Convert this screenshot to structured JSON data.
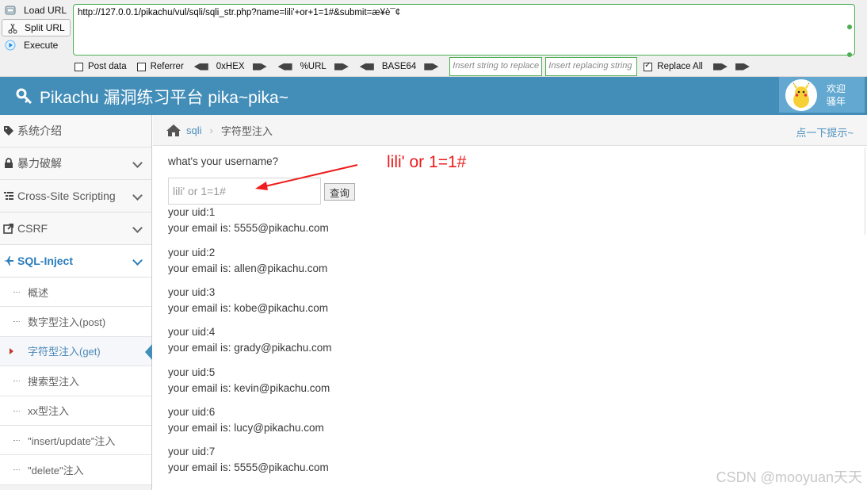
{
  "hackbar": {
    "load_url": "Load URL",
    "split_url": "Split URL",
    "execute": "Execute",
    "url": "http://127.0.0.1/pikachu/vul/sqli/sqli_str.php?name=lili'+or+1=1#&submit=æ¥è¯¢",
    "post_data": "Post data",
    "referrer": "Referrer",
    "hex": "0xHEX",
    "url_enc": "%URL",
    "base64": "BASE64",
    "insert_placeholder": "Insert string to replace",
    "replacing_placeholder": "Insert replacing string",
    "replace_all": "Replace All"
  },
  "header": {
    "title": "Pikachu 漏洞练习平台 pika~pika~",
    "welcome_line1": "欢迎",
    "welcome_line2": "骚年"
  },
  "sidebar": {
    "items": [
      {
        "label": "系统介绍",
        "icon": "tag-icon"
      },
      {
        "label": "暴力破解",
        "icon": "lock-icon"
      },
      {
        "label": "Cross-Site Scripting",
        "icon": "list-icon"
      },
      {
        "label": "CSRF",
        "icon": "share-icon"
      },
      {
        "label": "SQL-Inject",
        "icon": "plane-icon"
      }
    ],
    "sub_items": [
      "概述",
      "数字型注入(post)",
      "字符型注入(get)",
      "搜索型注入",
      "xx型注入",
      "\"insert/update\"注入",
      "\"delete\"注入"
    ]
  },
  "breadcrumb": {
    "link": "sqli",
    "current": "字符型注入",
    "hint": "点一下提示~"
  },
  "main": {
    "question": "what's your username?",
    "input_value": "lili' or 1=1#",
    "button": "查询",
    "results": [
      {
        "uid": "your uid:1",
        "email": "your email is: 5555@pikachu.com"
      },
      {
        "uid": "your uid:2",
        "email": "your email is: allen@pikachu.com"
      },
      {
        "uid": "your uid:3",
        "email": "your email is: kobe@pikachu.com"
      },
      {
        "uid": "your uid:4",
        "email": "your email is: grady@pikachu.com"
      },
      {
        "uid": "your uid:5",
        "email": "your email is: kevin@pikachu.com"
      },
      {
        "uid": "your uid:6",
        "email": "your email is: lucy@pikachu.com"
      },
      {
        "uid": "your uid:7",
        "email": "your email is: 5555@pikachu.com"
      }
    ]
  },
  "annotation": {
    "text": "lili' or 1=1#",
    "color": "#ee1c1c"
  },
  "watermark": "CSDN @mooyuan天天",
  "colors": {
    "header": "#438eb9",
    "accent": "#2b7dbc"
  }
}
